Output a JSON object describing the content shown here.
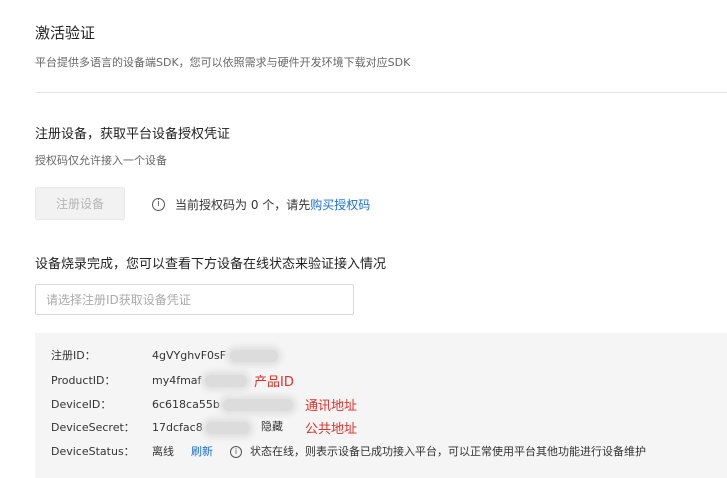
{
  "activation": {
    "title": "激活验证",
    "description": "平台提供多语言的设备端SDK，您可以依照需求与硬件开发环境下载对应SDK"
  },
  "register": {
    "title": "注册设备，获取平台设备授权凭证",
    "description": "授权码仅允许接入一个设备",
    "button_label": "注册设备",
    "info_text": "当前授权码为 0 个，请先",
    "buy_link": "购买授权码"
  },
  "verify": {
    "title": "设备烧录完成，您可以查看下方设备在线状态来验证接入情况",
    "select_placeholder": "请选择注册ID获取设备凭证"
  },
  "credentials": {
    "registration_id_label": "注册ID：",
    "registration_id_value": "4gVYghvF0sF",
    "product_id_label": "ProductID：",
    "product_id_value": "my4fmaf",
    "product_id_annotation": "产品ID",
    "device_id_label": "DeviceID：",
    "device_id_value": "6c618ca55b",
    "device_id_annotation": "通讯地址",
    "device_secret_label": "DeviceSecret：",
    "device_secret_value": "17dcfac8",
    "device_secret_hide": "隐藏",
    "device_secret_annotation": "公共地址",
    "device_status_label": "DeviceStatus：",
    "device_status_value": "离线",
    "refresh_label": "刷新",
    "status_note": "状态在线，则表示设备已成功接入平台，可以正常使用平台其他功能进行设备维护"
  },
  "colors": {
    "link": "#1a6ed8",
    "annotation": "#e0302c",
    "panel_background": "#f5f5f5"
  },
  "icons": [
    "info-circle-icon"
  ]
}
